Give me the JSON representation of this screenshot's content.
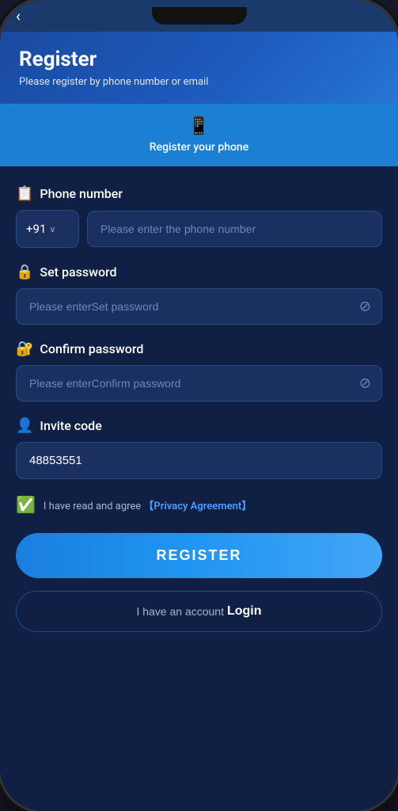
{
  "status_bar": {
    "back_label": "‹"
  },
  "header": {
    "title": "Register",
    "subtitle": "Please register by phone number or email"
  },
  "tab": {
    "icon": "📱",
    "label": "Register your phone"
  },
  "form": {
    "phone_number": {
      "label": "Phone number",
      "country_code": "+91",
      "dropdown_arrow": "∨",
      "placeholder": "Please enter the phone number"
    },
    "set_password": {
      "label": "Set password",
      "placeholder": "Please enterSet password"
    },
    "confirm_password": {
      "label": "Confirm password",
      "placeholder": "Please enterConfirm password"
    },
    "invite_code": {
      "label": "Invite code",
      "value": "48853551"
    },
    "agreement": {
      "text": "I have read and agree ",
      "link": "【Privacy Agreement】"
    }
  },
  "buttons": {
    "register": "Register",
    "login_prefix": "I have an account ",
    "login": "Login"
  },
  "icons": {
    "phone_icon": "📱",
    "lock_icon": "🔒",
    "user_icon": "👤",
    "eye_off": "⊘",
    "check": "✅"
  }
}
